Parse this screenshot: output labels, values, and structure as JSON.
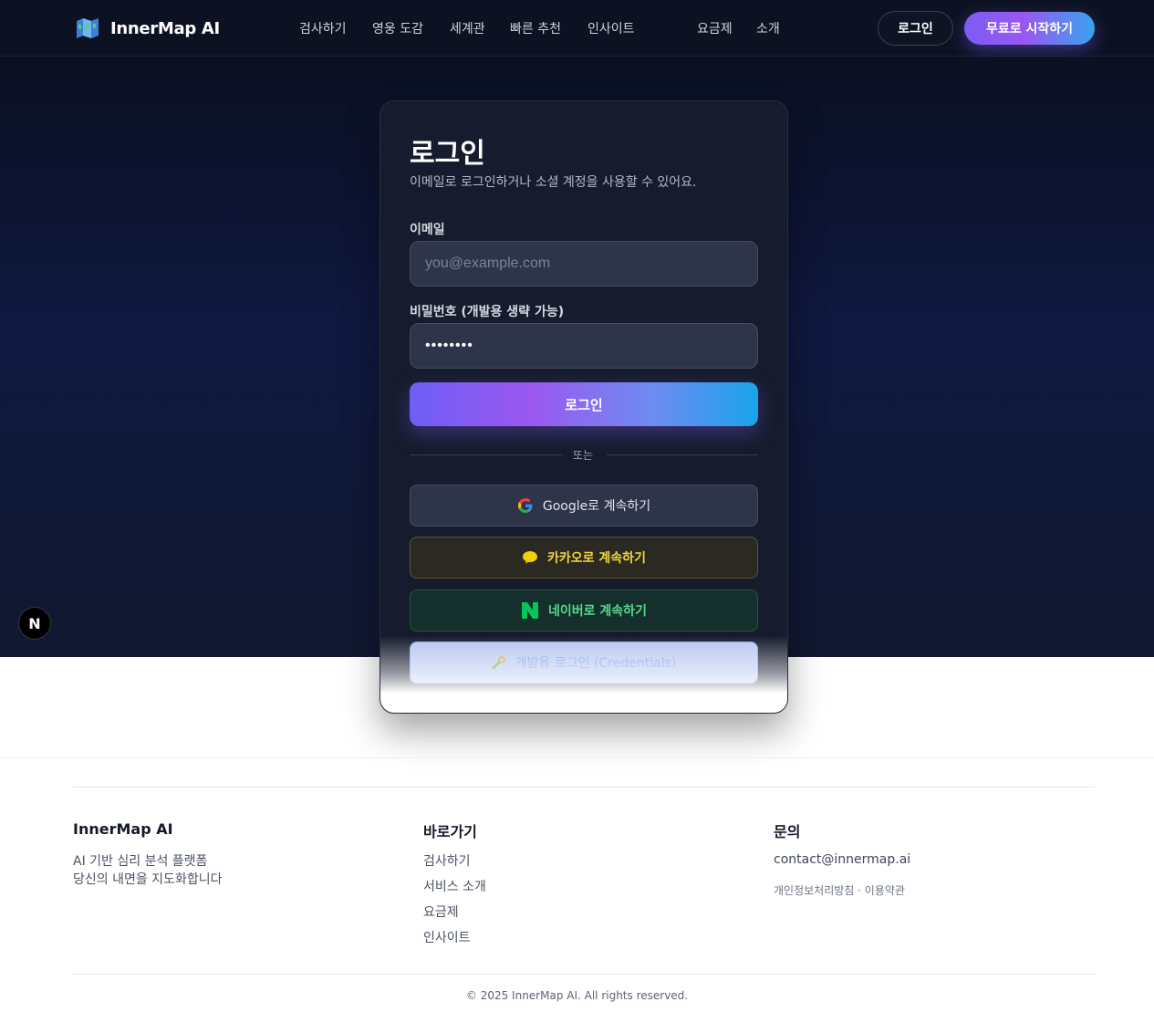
{
  "header": {
    "brand": "InnerMap AI",
    "nav": [
      "검사하기",
      "영웅 도감",
      "세계관",
      "빠른 추천",
      "인사이트",
      "요금제",
      "소개"
    ],
    "login_label": "로그인",
    "start_label": "무료로 시작하기"
  },
  "login": {
    "title": "로그인",
    "subtitle": "이메일로 로그인하거나 소셜 계정을 사용할 수 있어요.",
    "email_label": "이메일",
    "email_placeholder": "you@example.com",
    "password_label": "비밀번호 (개발용 생략 가능)",
    "password_value": "••••••••",
    "submit_label": "로그인",
    "divider": "또는",
    "google": "Google로 계속하기",
    "kakao": "카카오로 계속하기",
    "naver": "네이버로 계속하기",
    "dev": "개발용 로그인 (Credentials)"
  },
  "badge": "N",
  "footer": {
    "brand": "InnerMap AI",
    "desc": [
      "AI 기반 심리 분석 플랫폼",
      "당신의 내면을 지도화합니다"
    ],
    "quick_title": "바로가기",
    "quick_links": [
      "검사하기",
      "서비스 소개",
      "요금제",
      "인사이트"
    ],
    "contact_title": "문의",
    "contact_email": "contact@innermap.ai",
    "legal": "개인정보처리방침 · 이용약관",
    "copyright": "© 2025 InnerMap AI. All rights reserved."
  },
  "colors": {
    "header_bg": "#0d1222",
    "card_bg": "#161c2e",
    "accent_purple": "#7c5cf5",
    "accent_blue": "#19a4ea",
    "kakao_yellow": "#f5d53c",
    "naver_green": "#03c75a"
  }
}
